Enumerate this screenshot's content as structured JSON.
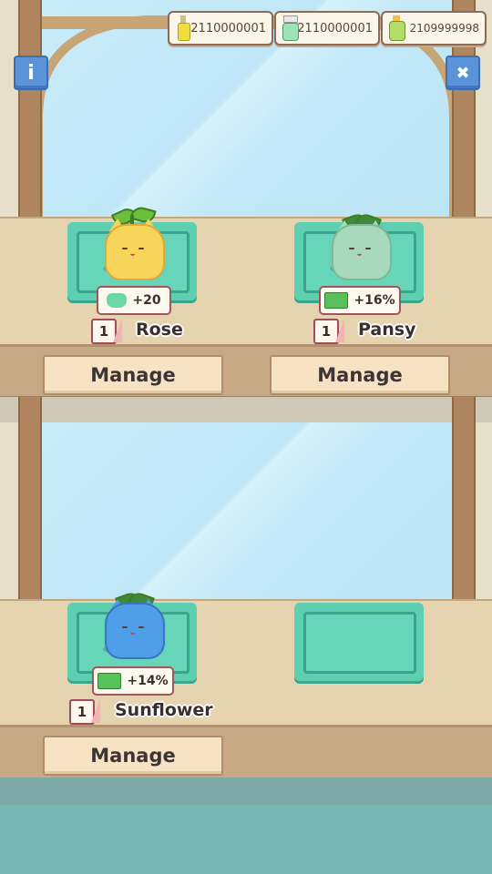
{
  "resources": [
    {
      "value": "2110000001",
      "icon": "yellow-bottle-icon"
    },
    {
      "value": "2110000001",
      "icon": "spray-bottle-icon"
    },
    {
      "value": "2109999998",
      "icon": "fertilizer-bottle-icon"
    }
  ],
  "buttons": {
    "info_label": "i",
    "close_label": "✖"
  },
  "shelves": [
    {
      "slots": [
        {
          "name": "Rose",
          "level": "1",
          "bonus": "+20",
          "bonus_icon": "cat-face-icon",
          "color": "#f7d45a"
        },
        {
          "name": "Pansy",
          "level": "1",
          "bonus": "+16%",
          "bonus_icon": "money-up-icon",
          "color": "#a8d9bd"
        }
      ],
      "manage_labels": [
        "Manage",
        "Manage"
      ]
    },
    {
      "slots": [
        {
          "name": "Sunflower",
          "level": "1",
          "bonus": "+14%",
          "bonus_icon": "money-up-icon",
          "color": "#4f9ee8"
        }
      ],
      "manage_labels": [
        "Manage"
      ]
    }
  ],
  "colors": {
    "pad": "#5fcfb1",
    "wood": "#b08660",
    "sky": "#c9ecf9",
    "floor": "#78b8b4"
  }
}
